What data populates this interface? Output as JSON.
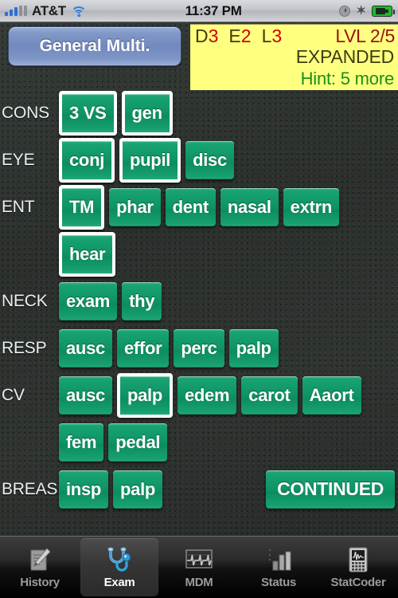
{
  "status_bar": {
    "carrier": "AT&T",
    "time": "11:37 PM",
    "signal_icon": "signal-bars-icon",
    "wifi_icon": "wifi-icon",
    "alarm_icon": "alarm-clock-icon",
    "bluetooth_icon": "bluetooth-icon",
    "bluetooth_glyph": "✶",
    "battery_icon": "battery-charging-icon"
  },
  "header": {
    "category_label": "General Multi.",
    "level_panel": {
      "codes": [
        {
          "key": "D",
          "value": "3"
        },
        {
          "key": "E",
          "value": "2"
        },
        {
          "key": "L",
          "value": "3"
        }
      ],
      "level_label": "LVL 2/5",
      "status": "EXPANDED",
      "hint": "Hint: 5 more"
    }
  },
  "colors": {
    "button_green": "#0f9566",
    "category_blue": "#7189bd",
    "panel_yellow": "#ffff80",
    "code_value_red": "#cc0000",
    "level_red": "#991111",
    "hint_green": "#1a8f1a",
    "background_dark": "#2f3431"
  },
  "exam_rows": [
    {
      "label": "CONS",
      "buttons": [
        {
          "label": "3 VS",
          "selected": true
        },
        {
          "label": "gen",
          "selected": true
        }
      ]
    },
    {
      "label": "EYE",
      "buttons": [
        {
          "label": "conj",
          "selected": true
        },
        {
          "label": "pupil",
          "selected": true
        },
        {
          "label": "disc",
          "selected": false
        }
      ]
    },
    {
      "label": "ENT",
      "buttons": [
        {
          "label": "TM",
          "selected": true
        },
        {
          "label": "phar",
          "selected": false
        },
        {
          "label": "dent",
          "selected": false
        },
        {
          "label": "nasal",
          "selected": false
        },
        {
          "label": "extrn",
          "selected": false
        }
      ]
    },
    {
      "label": "",
      "buttons": [
        {
          "label": "hear",
          "selected": true
        }
      ]
    },
    {
      "label": "NECK",
      "buttons": [
        {
          "label": "exam",
          "selected": false
        },
        {
          "label": "thy",
          "selected": false
        }
      ]
    },
    {
      "label": "RESP",
      "buttons": [
        {
          "label": "ausc",
          "selected": false
        },
        {
          "label": "effor",
          "selected": false
        },
        {
          "label": "perc",
          "selected": false
        },
        {
          "label": "palp",
          "selected": false
        }
      ]
    },
    {
      "label": "CV",
      "buttons": [
        {
          "label": "ausc",
          "selected": false
        },
        {
          "label": "palp",
          "selected": true
        },
        {
          "label": "edem",
          "selected": false
        },
        {
          "label": "carot",
          "selected": false
        },
        {
          "label": "Aaort",
          "selected": false
        }
      ]
    },
    {
      "label": "",
      "buttons": [
        {
          "label": "fem",
          "selected": false
        },
        {
          "label": "pedal",
          "selected": false
        }
      ]
    },
    {
      "label": "BREAS",
      "buttons": [
        {
          "label": "insp",
          "selected": false
        },
        {
          "label": "palp",
          "selected": false
        },
        {
          "label": "CONTINUED",
          "selected": false,
          "wide": true
        }
      ]
    }
  ],
  "tab_bar": {
    "tabs": [
      {
        "label": "History",
        "icon": "notepad-pen-icon",
        "active": false
      },
      {
        "label": "Exam",
        "icon": "stethoscope-icon",
        "active": true
      },
      {
        "label": "MDM",
        "icon": "ekg-monitor-icon",
        "active": false
      },
      {
        "label": "Status",
        "icon": "bar-chart-icon",
        "active": false
      },
      {
        "label": "StatCoder",
        "icon": "calculator-waveform-icon",
        "active": false
      }
    ]
  }
}
